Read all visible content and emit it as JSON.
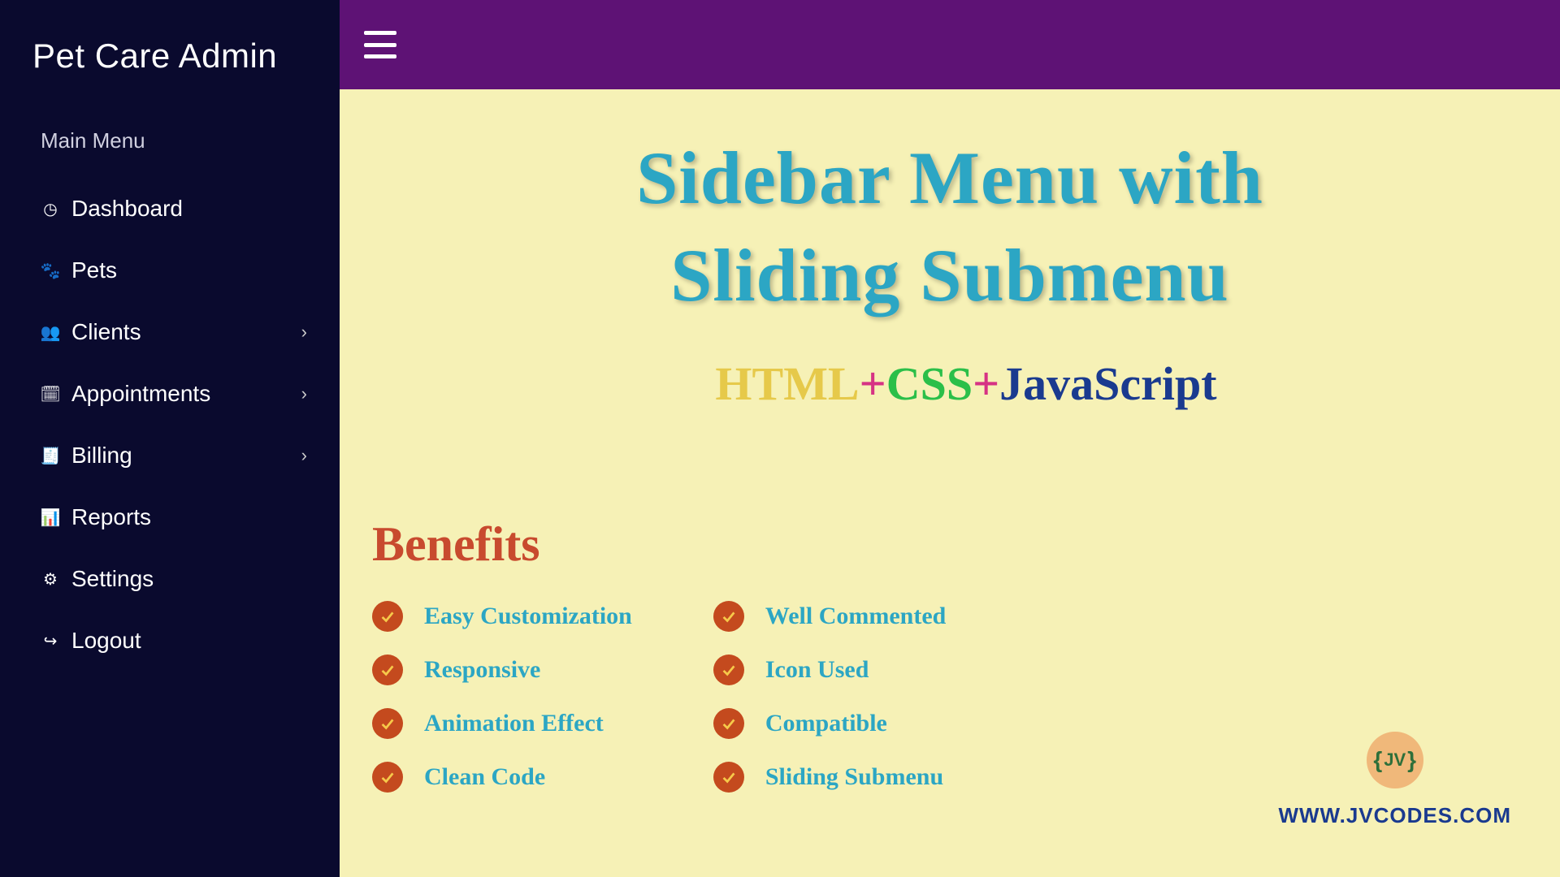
{
  "sidebar": {
    "title": "Pet Care Admin",
    "menu_header": "Main Menu",
    "items": [
      {
        "icon": "gauge-icon",
        "glyph": "◷",
        "label": "Dashboard",
        "has_submenu": false
      },
      {
        "icon": "paw-icon",
        "glyph": "🐾",
        "label": "Pets",
        "has_submenu": false
      },
      {
        "icon": "people-icon",
        "glyph": "👥",
        "label": "Clients",
        "has_submenu": true
      },
      {
        "icon": "calendar-icon",
        "glyph": "🗓",
        "label": "Appointments",
        "has_submenu": true
      },
      {
        "icon": "file-icon",
        "glyph": "🧾",
        "label": "Billing",
        "has_submenu": true
      },
      {
        "icon": "chart-icon",
        "glyph": "📊",
        "label": "Reports",
        "has_submenu": false
      },
      {
        "icon": "gear-icon",
        "glyph": "⚙",
        "label": "Settings",
        "has_submenu": false
      },
      {
        "icon": "logout-icon",
        "glyph": "↪",
        "label": "Logout",
        "has_submenu": false
      }
    ]
  },
  "content": {
    "hero_line1": "Sidebar Menu with",
    "hero_line2": "Sliding Submenu",
    "tech": {
      "html": "HTML",
      "plus1": "+",
      "css": "CSS",
      "plus2": "+",
      "js": "JavaScript"
    },
    "benefits_title": "Benefits",
    "benefits_col1": [
      "Easy Customization",
      "Responsive",
      "Animation Effect",
      "Clean Code"
    ],
    "benefits_col2": [
      "Well Commented",
      "Icon Used",
      "Compatible",
      "Sliding Submenu"
    ],
    "brand": {
      "logo_text": "JV",
      "url": "WWW.JVCODES.COM"
    }
  }
}
